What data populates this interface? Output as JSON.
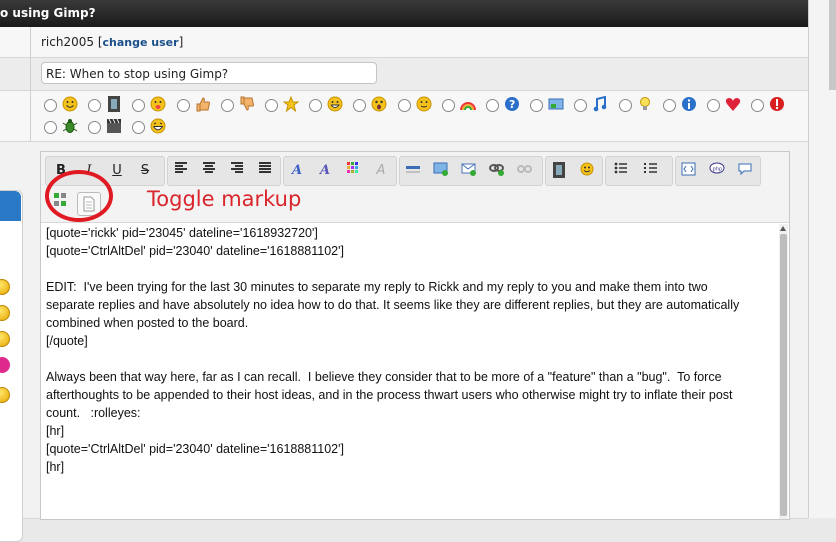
{
  "window": {
    "title": "o using Gimp?"
  },
  "user": {
    "name": "rich2005",
    "change_user": "change user",
    "bracket_open": "[",
    "bracket_close": "]"
  },
  "subject": {
    "value": "RE: When to stop using Gimp?"
  },
  "smilies": [
    "smile",
    "film",
    "tongue",
    "thumbs-up",
    "thumbs-down",
    "star",
    "grin",
    "shocked",
    "happy",
    "rainbow",
    "question",
    "image",
    "music",
    "bulb",
    "info",
    "heart",
    "exclamation",
    "bug",
    "clapperboard",
    "laugh"
  ],
  "toolbar": {
    "bold": "B",
    "italic": "I",
    "underline": "U",
    "strike": "S",
    "font_a": "A",
    "font_a2": "A"
  },
  "annotation": {
    "label": "Toggle markup",
    "color": "#d9252b"
  },
  "post_lines": [
    "[quote='rickk' pid='23045' dateline='1618932720']",
    "[quote='CtrlAltDel' pid='23040' dateline='1618881102']",
    "",
    "EDIT:  I've been trying for the last 30 minutes to separate my reply to Rickk and my reply to you and make them into two",
    "separate replies and have absolutely no idea how to do that. It seems like they are different replies, but they are automatically",
    "combined when posted to the board.",
    "[/quote]",
    "",
    "Always been that way here, far as I can recall.  I believe they consider that to be more of a \"feature\" than a \"bug\".  To force",
    "afterthoughts to be appended to their host ideas, and in the process thwart users who otherwise might try to inflate their post",
    "count.   :rolleyes:",
    "[hr]",
    "[quote='CtrlAltDel' pid='23040' dateline='1618881102']",
    "[hr]"
  ]
}
